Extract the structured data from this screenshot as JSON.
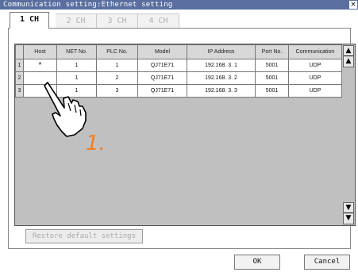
{
  "window": {
    "title": "Communication setting:Ethernet setting",
    "close_label": "×"
  },
  "tabs": [
    {
      "label": "1 CH",
      "active": true
    },
    {
      "label": "2 CH",
      "active": false
    },
    {
      "label": "3 CH",
      "active": false
    },
    {
      "label": "4 CH",
      "active": false
    }
  ],
  "table": {
    "columns": [
      "",
      "Host",
      "NET No.",
      "PLC No.",
      "Model",
      "IP Address",
      "Port No.",
      "Communication"
    ],
    "rows": [
      {
        "num": "1",
        "host": "*",
        "net": "1",
        "plc": "1",
        "model": "QJ71E71",
        "ip": "192.168.  3.  1",
        "port": "5001",
        "comm": "UDP"
      },
      {
        "num": "2",
        "host": "",
        "net": "1",
        "plc": "2",
        "model": "QJ71E71",
        "ip": "192.168.  3.  2",
        "port": "5001",
        "comm": "UDP"
      },
      {
        "num": "3",
        "host": "",
        "net": "1",
        "plc": "3",
        "model": "QJ71E71",
        "ip": "192.168.  3.  3",
        "port": "5001",
        "comm": "UDP"
      }
    ]
  },
  "scroll": {
    "top_label": "▲",
    "bottom_label": "▼"
  },
  "buttons": {
    "restore": "Restore default settings",
    "ok": "OK",
    "cancel": "Cancel"
  },
  "annotation": {
    "callout": "1."
  },
  "colors": {
    "titlebar": "#5a6fa0",
    "callout": "#f08020"
  }
}
